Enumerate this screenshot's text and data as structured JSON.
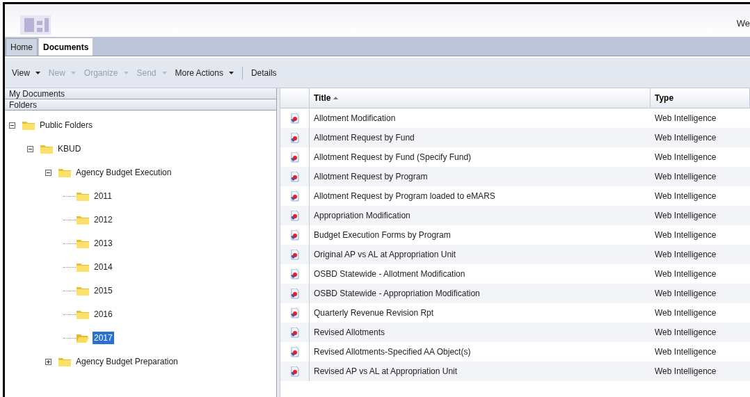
{
  "header": {
    "welcome": "We"
  },
  "tabs": [
    {
      "label": "Home",
      "selected": false
    },
    {
      "label": "Documents",
      "selected": true
    }
  ],
  "toolbar": [
    {
      "label": "View",
      "disabled": false,
      "kind": "menu"
    },
    {
      "label": "New",
      "disabled": true,
      "kind": "menu"
    },
    {
      "label": "Organize",
      "disabled": true,
      "kind": "menu"
    },
    {
      "label": "Send",
      "disabled": true,
      "kind": "menu"
    },
    {
      "label": "More Actions",
      "disabled": false,
      "kind": "menu"
    },
    {
      "label": "Details",
      "disabled": false,
      "kind": "button"
    }
  ],
  "sidebar": {
    "sections": [
      "My Documents",
      "Folders"
    ],
    "tree": [
      {
        "label": "Public Folders",
        "expanded": true,
        "selected": false,
        "children": [
          {
            "label": "KBUD",
            "expanded": true,
            "selected": false,
            "children": [
              {
                "label": "Agency Budget Execution",
                "expanded": true,
                "selected": false,
                "children": [
                  {
                    "label": "2011",
                    "selected": false
                  },
                  {
                    "label": "2012",
                    "selected": false
                  },
                  {
                    "label": "2013",
                    "selected": false
                  },
                  {
                    "label": "2014",
                    "selected": false
                  },
                  {
                    "label": "2015",
                    "selected": false
                  },
                  {
                    "label": "2016",
                    "selected": false
                  },
                  {
                    "label": "2017",
                    "selected": true
                  }
                ]
              },
              {
                "label": "Agency Budget Preparation",
                "expanded": false,
                "selected": false
              }
            ]
          }
        ]
      }
    ]
  },
  "table": {
    "columns": [
      {
        "label": "Title",
        "sorted": true
      },
      {
        "label": "Type",
        "sorted": false
      }
    ],
    "rows": [
      {
        "title": "Allotment Modification",
        "type": "Web Intelligence"
      },
      {
        "title": "Allotment Request by Fund",
        "type": "Web Intelligence"
      },
      {
        "title": "Allotment Request by Fund (Specify Fund)",
        "type": "Web Intelligence"
      },
      {
        "title": "Allotment Request by Program",
        "type": "Web Intelligence"
      },
      {
        "title": "Allotment Request by Program loaded to eMARS",
        "type": "Web Intelligence"
      },
      {
        "title": "Appropriation Modification",
        "type": "Web Intelligence"
      },
      {
        "title": "Budget Execution Forms by Program",
        "type": "Web Intelligence"
      },
      {
        "title": "Original AP vs AL at Appropriation Unit",
        "type": "Web Intelligence"
      },
      {
        "title": "OSBD Statewide - Allotment Modification",
        "type": "Web Intelligence"
      },
      {
        "title": "OSBD Statewide - Appropriation Modification",
        "type": "Web Intelligence"
      },
      {
        "title": "Quarterly Revenue Revision Rpt",
        "type": "Web Intelligence"
      },
      {
        "title": "Revised Allotments",
        "type": "Web Intelligence"
      },
      {
        "title": "Revised Allotments-Specified AA Object(s)",
        "type": "Web Intelligence"
      },
      {
        "title": "Revised AP vs AL at Appropriation Unit",
        "type": "Web Intelligence"
      }
    ]
  }
}
